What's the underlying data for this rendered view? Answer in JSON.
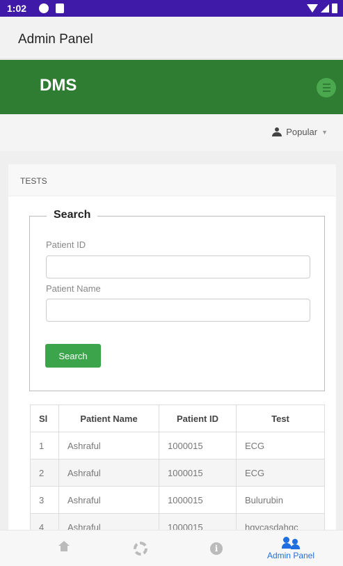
{
  "status_bar": {
    "time": "1:02"
  },
  "app_bar": {
    "title": "Admin Panel"
  },
  "brand": {
    "name": "DMS",
    "menu_icon": "menu-icon"
  },
  "user_menu": {
    "label": "Popular",
    "icon": "user-icon"
  },
  "card": {
    "title": "TESTS",
    "search": {
      "legend": "Search",
      "patient_id_label": "Patient ID",
      "patient_id_value": "",
      "patient_name_label": "Patient Name",
      "patient_name_value": "",
      "button_label": "Search"
    },
    "table": {
      "columns": [
        "Sl",
        "Patient Name",
        "Patient ID",
        "Test"
      ],
      "rows": [
        [
          "1",
          "Ashraful",
          "1000015",
          "ECG"
        ],
        [
          "2",
          "Ashraful",
          "1000015",
          "ECG"
        ],
        [
          "3",
          "Ashraful",
          "1000015",
          "Bulurubin"
        ],
        [
          "4",
          "Ashraful",
          "1000015",
          "hgvcasdahgc"
        ]
      ]
    }
  },
  "bottom_nav": {
    "items": [
      {
        "icon": "home-icon",
        "label": ""
      },
      {
        "icon": "gear-icon",
        "label": ""
      },
      {
        "icon": "info-icon",
        "label": ""
      },
      {
        "icon": "admin-users-icon",
        "label": "Admin Panel",
        "active": true
      }
    ],
    "active_color": "#1f6fe0"
  },
  "colors": {
    "status_bar": "#3f1aa8",
    "brand": "#2f7d32",
    "button": "#3ca44a"
  }
}
